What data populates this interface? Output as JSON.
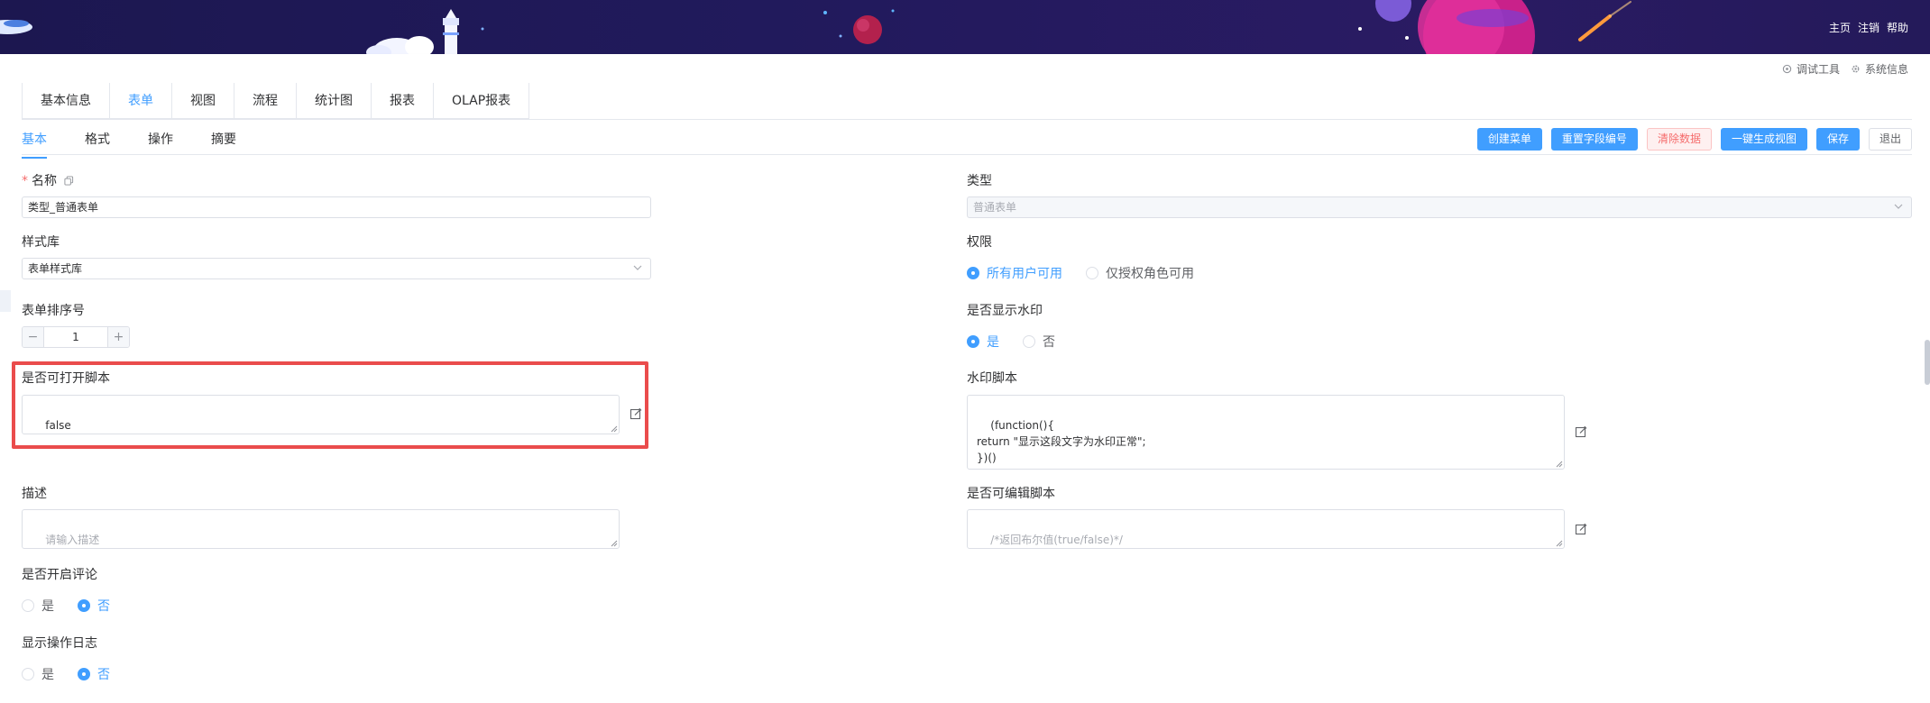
{
  "header": {
    "links": [
      "主页",
      "注销",
      "帮助"
    ],
    "tools": [
      {
        "icon": "bug-icon",
        "label": "调试工具"
      },
      {
        "icon": "gear-icon",
        "label": "系统信息"
      }
    ]
  },
  "tabs": [
    "基本信息",
    "表单",
    "视图",
    "流程",
    "统计图",
    "报表",
    "OLAP报表"
  ],
  "active_tab": "表单",
  "subtabs": [
    "基本",
    "格式",
    "操作",
    "摘要"
  ],
  "active_subtab": "基本",
  "actions": {
    "create_menu": "创建菜单",
    "reset_field_no": "重置字段编号",
    "clear_data": "清除数据",
    "generate_view": "一键生成视图",
    "save": "保存",
    "exit": "退出"
  },
  "form": {
    "name": {
      "label": "名称",
      "value": "类型_普通表单"
    },
    "type": {
      "label": "类型",
      "value": "普通表单"
    },
    "style_lib": {
      "label": "样式库",
      "value": "表单样式库"
    },
    "permission": {
      "label": "权限",
      "options": [
        "所有用户可用",
        "仅授权角色可用"
      ],
      "selected": 0
    },
    "sort_no": {
      "label": "表单排序号",
      "value": "1",
      "minus": "−",
      "plus": "+"
    },
    "show_watermark": {
      "label": "是否显示水印",
      "options": [
        "是",
        "否"
      ],
      "selected": 0
    },
    "open_script": {
      "label": "是否可打开脚本",
      "value": "false"
    },
    "watermark_script": {
      "label": "水印脚本",
      "value": "(function(){\nreturn \"显示这段文字为水印正常\";\n})()"
    },
    "description": {
      "label": "描述",
      "placeholder": "请输入描述"
    },
    "edit_script": {
      "label": "是否可编辑脚本",
      "placeholder": "/*返回布尔值(true/false)*/"
    },
    "enable_comment": {
      "label": "是否开启评论",
      "options": [
        "是",
        "否"
      ],
      "selected": 1
    },
    "show_log": {
      "label": "显示操作日志",
      "options": [
        "是",
        "否"
      ],
      "selected": 1
    }
  },
  "colors": {
    "primary": "#409eff",
    "danger": "#f56c6c",
    "highlight": "#ea4c4c",
    "banner": "#1c1750"
  }
}
